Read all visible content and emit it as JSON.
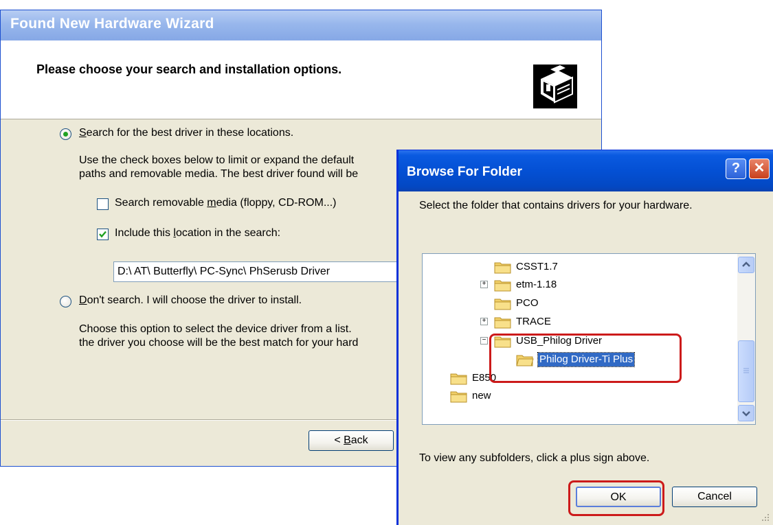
{
  "wizard": {
    "title": "Found New Hardware Wizard",
    "heading": "Please choose your search and installation options.",
    "search_option": {
      "label_prefix": "",
      "accel": "S",
      "label_rest": "earch for the best driver in these locations.",
      "checked": true,
      "description_line1": "Use the check boxes below to limit or expand the default",
      "description_line2": "paths and removable media. The best driver found will be"
    },
    "removable_media": {
      "label_prefix": "Search removable ",
      "accel": "m",
      "label_rest": "edia (floppy, CD-ROM...)",
      "checked": false
    },
    "include_location": {
      "label_prefix": "Include this ",
      "accel": "l",
      "label_rest": "ocation in the search:",
      "checked": true
    },
    "location_path": "D:\\ AT\\ Butterfly\\ PC-Sync\\ PhSerusb Driver",
    "dont_search_option": {
      "accel": "D",
      "label_rest": "on't search. I will choose the driver to install.",
      "checked": false,
      "description_line1": "Choose this option to select the device driver from a list. ",
      "description_line2": "the driver you choose will be the best match for your hard"
    },
    "back_button": {
      "prefix": "< ",
      "accel": "B",
      "rest": "ack"
    }
  },
  "browse": {
    "title": "Browse For Folder",
    "help_glyph": "?",
    "close_glyph": "✕",
    "instruction": "Select the folder that contains drivers for your hardware.",
    "tree": {
      "items": [
        {
          "label": "CSST1.7",
          "expander": ""
        },
        {
          "label": "etm-1.18",
          "expander": "+"
        },
        {
          "label": "PCO",
          "expander": ""
        },
        {
          "label": "TRACE",
          "expander": "+"
        },
        {
          "label": "USB_Philog Driver",
          "expander": "−"
        },
        {
          "label": "Philog Driver-Ti Plus",
          "expander": "",
          "selected": true
        },
        {
          "label": "E850",
          "expander": ""
        },
        {
          "label": "new",
          "expander": ""
        }
      ]
    },
    "hint": "To view any subfolders, click a plus sign above.",
    "ok_label": "OK",
    "cancel_label": "Cancel"
  },
  "colors": {
    "selection": "#316ac5",
    "highlight_annotation": "#cc1a1a",
    "folder_yellow": "#f2d16b"
  }
}
